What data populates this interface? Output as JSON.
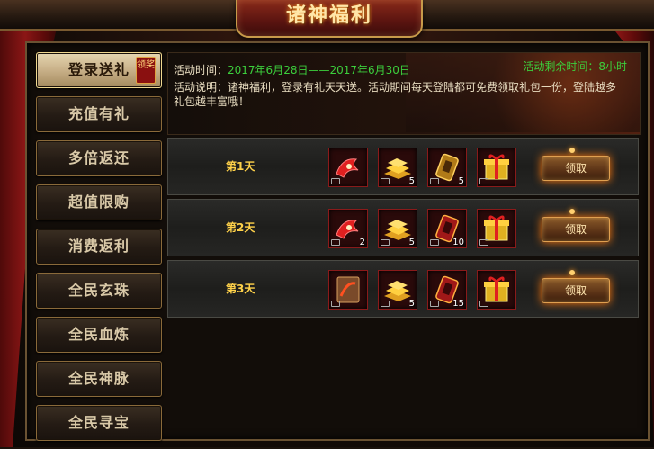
{
  "window": {
    "title": "诸神福利"
  },
  "sidebar": {
    "badge": "领奖",
    "items": [
      {
        "label": "登录送礼",
        "active": true
      },
      {
        "label": "充值有礼",
        "active": false
      },
      {
        "label": "多倍返还",
        "active": false
      },
      {
        "label": "超值限购",
        "active": false
      },
      {
        "label": "消费返利",
        "active": false
      },
      {
        "label": "全民玄珠",
        "active": false
      },
      {
        "label": "全民血炼",
        "active": false
      },
      {
        "label": "全民神脉",
        "active": false
      },
      {
        "label": "全民寻宝",
        "active": false
      }
    ]
  },
  "activity": {
    "time_label": "活动时间：",
    "time_value": "2017年6月28日——2017年6月30日",
    "remaining": "活动剩余时间：8小时",
    "description": "活动说明：诸神福利，登录有礼天天送。活动期间每天登陆都可免费领取礼包一份，登陆越多礼包越丰富哦！"
  },
  "rewards": [
    {
      "day": "第1天",
      "items": [
        {
          "icon": "red-claw-icon",
          "count": ""
        },
        {
          "icon": "gold-bars-icon",
          "count": "5"
        },
        {
          "icon": "gold-amulet-icon",
          "count": "5"
        },
        {
          "icon": "gift-box-icon",
          "count": ""
        }
      ],
      "claim_label": "领取"
    },
    {
      "day": "第2天",
      "items": [
        {
          "icon": "red-claw-icon",
          "count": "2"
        },
        {
          "icon": "gold-bars-icon",
          "count": "5"
        },
        {
          "icon": "red-amulet-icon",
          "count": "10"
        },
        {
          "icon": "gift-box-icon",
          "count": ""
        }
      ],
      "claim_label": "领取"
    },
    {
      "day": "第3天",
      "items": [
        {
          "icon": "scroll-icon",
          "count": ""
        },
        {
          "icon": "gold-bars-icon",
          "count": "5"
        },
        {
          "icon": "red-amulet-icon",
          "count": "15"
        },
        {
          "icon": "gift-box-icon",
          "count": ""
        }
      ],
      "claim_label": "领取"
    }
  ],
  "colors": {
    "accent_gold": "#ffd24a",
    "timer_green": "#3ccf3c",
    "claim_glow": "#ff7a10"
  }
}
